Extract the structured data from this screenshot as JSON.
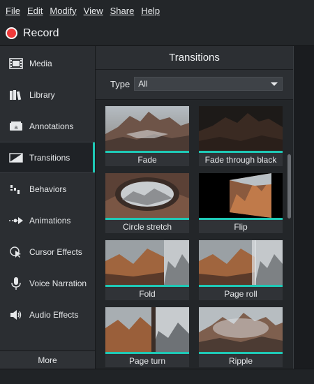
{
  "menu": {
    "items": [
      "File",
      "Edit",
      "Modify",
      "View",
      "Share",
      "Help"
    ]
  },
  "record": {
    "label": "Record",
    "color": "#ee3a3a"
  },
  "sidebar": {
    "items": [
      {
        "label": "Media",
        "icon": "media-filmstrip-icon"
      },
      {
        "label": "Library",
        "icon": "library-books-icon"
      },
      {
        "label": "Annotations",
        "icon": "annotations-callout-icon"
      },
      {
        "label": "Transitions",
        "icon": "transitions-icon",
        "active": true
      },
      {
        "label": "Behaviors",
        "icon": "behaviors-icon"
      },
      {
        "label": "Animations",
        "icon": "animations-arrow-icon"
      },
      {
        "label": "Cursor Effects",
        "icon": "cursor-effects-icon"
      },
      {
        "label": "Voice Narration",
        "icon": "microphone-icon"
      },
      {
        "label": "Audio Effects",
        "icon": "speaker-icon"
      }
    ],
    "more_label": "More"
  },
  "panel": {
    "title": "Transitions",
    "type_label": "Type",
    "type_value": "All"
  },
  "transitions": [
    {
      "label": "Fade"
    },
    {
      "label": "Fade through black"
    },
    {
      "label": "Circle stretch"
    },
    {
      "label": "Flip"
    },
    {
      "label": "Fold"
    },
    {
      "label": "Page roll"
    },
    {
      "label": "Page turn"
    },
    {
      "label": "Ripple"
    }
  ],
  "colors": {
    "accent": "#1fc9b6"
  }
}
